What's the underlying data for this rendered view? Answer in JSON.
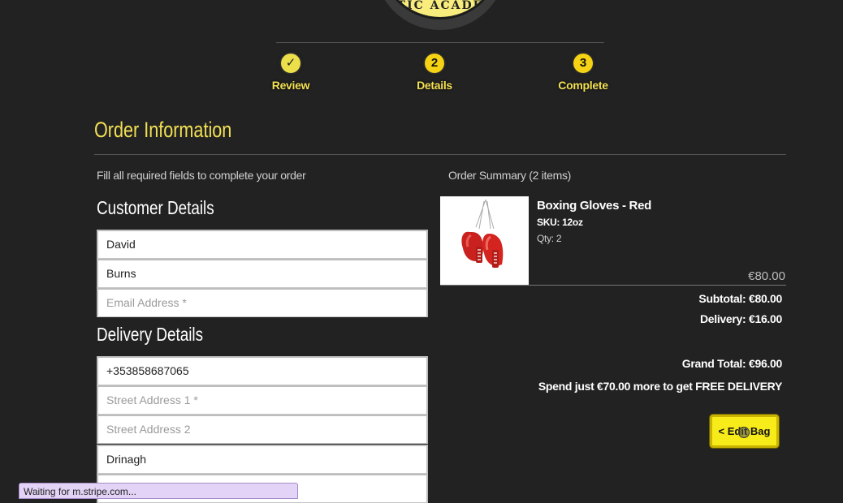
{
  "brand": {
    "logo_text": "TIC ACADE"
  },
  "steps": [
    {
      "number": "✓",
      "label": "Review"
    },
    {
      "number": "2",
      "label": "Details"
    },
    {
      "number": "3",
      "label": "Complete"
    }
  ],
  "order": {
    "title": "Order Information",
    "instructions": "Fill all required fields to complete your order"
  },
  "customer": {
    "title": "Customer Details",
    "first_name_value": "David",
    "last_name_value": "Burns",
    "email_placeholder": "Email Address *"
  },
  "delivery": {
    "title": "Delivery Details",
    "phone_value": "+353858687065",
    "street1_placeholder": "Street Address 1 *",
    "street2_placeholder": "Street Address 2",
    "town_value": "Drinagh"
  },
  "summary": {
    "title": "Order Summary (2 items)",
    "item": {
      "name": "Boxing Gloves - Red",
      "sku": "SKU: 12oz",
      "qty": "Qty: 2",
      "price": "€80.00"
    },
    "subtotal": "Subtotal: €80.00",
    "delivery": "Delivery: €16.00",
    "grand_total": "Grand Total: €96.00",
    "free_delivery_note": "Spend just €70.00 more to get FREE DELIVERY",
    "edit_bag_label": "< Edit Bag"
  },
  "status": {
    "text": "Waiting for m.stripe.com..."
  },
  "colors": {
    "accent": "#f2e054",
    "background": "#222222",
    "button": "#f7ec1a"
  }
}
